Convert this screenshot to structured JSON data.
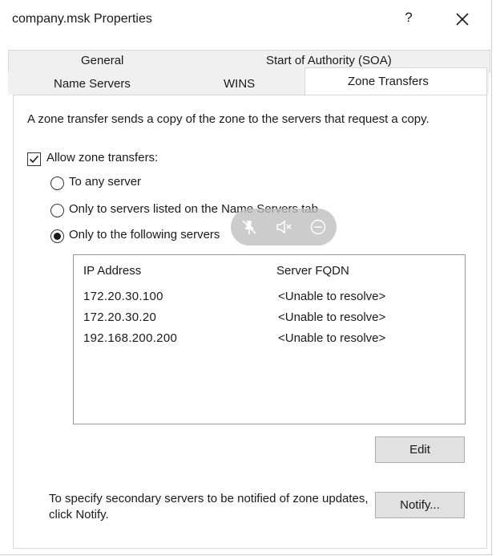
{
  "window": {
    "title": "company.msk Properties",
    "help_label": "?"
  },
  "tabs": {
    "row1": [
      "General",
      "Start of Authority (SOA)"
    ],
    "row2": [
      "Name Servers",
      "WINS",
      "Zone Transfers"
    ],
    "active": "Zone Transfers"
  },
  "panel": {
    "description": "A zone transfer sends a copy of the zone to the servers that request a copy.",
    "allow_label": "Allow zone transfers:",
    "allow_checked": true,
    "options": [
      {
        "label": "To any server",
        "selected": false
      },
      {
        "label": "Only to servers listed on the Name Servers tab",
        "selected": false
      },
      {
        "label": "Only to the following servers",
        "selected": true
      }
    ],
    "servers_table": {
      "columns": [
        "IP Address",
        "Server FQDN"
      ],
      "rows": [
        {
          "ip": "172.20.30.100",
          "fqdn": "<Unable to resolve>"
        },
        {
          "ip": "172.20.30.20",
          "fqdn": "<Unable to resolve>"
        },
        {
          "ip": "192.168.200.200",
          "fqdn": "<Unable to resolve>"
        }
      ]
    },
    "edit_label": "Edit",
    "notify_text": "To specify secondary servers to be notified of zone updates, click Notify.",
    "notify_label": "Notify..."
  },
  "overlay": {
    "icons": [
      "pin-off-icon",
      "mute-icon",
      "minus-circle-icon"
    ]
  }
}
